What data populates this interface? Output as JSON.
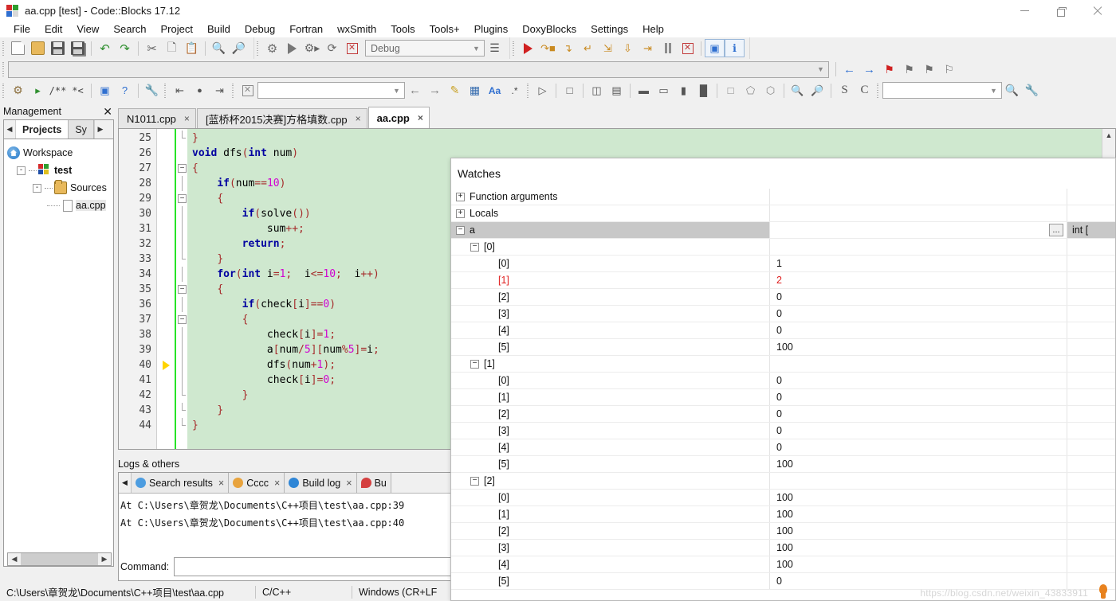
{
  "window": {
    "title": "aa.cpp [test] - Code::Blocks 17.12",
    "app_icon": "codeblocks-icon",
    "controls": {
      "minimize": "minimize-button",
      "maximize": "maximize-button",
      "close": "close-button"
    }
  },
  "menubar": {
    "items": [
      "File",
      "Edit",
      "View",
      "Search",
      "Project",
      "Build",
      "Debug",
      "Fortran",
      "wxSmith",
      "Tools",
      "Tools+",
      "Plugins",
      "DoxyBlocks",
      "Settings",
      "Help"
    ]
  },
  "toolbars": {
    "main": {
      "icons": [
        "new-file-icon",
        "open-file-icon",
        "save-icon",
        "save-all-icon",
        "undo-icon",
        "redo-icon",
        "cut-icon",
        "copy-icon",
        "paste-icon",
        "find-icon",
        "replace-icon"
      ]
    },
    "compiler": {
      "icons": [
        "build-icon",
        "run-icon",
        "build-and-run-icon",
        "rebuild-icon",
        "abort-icon"
      ],
      "target_value": "Debug",
      "target_arrow": "chevron-down-icon",
      "targets_icon": "select-target-icon"
    },
    "debugger": {
      "icons": [
        "debug-continue-icon",
        "next-line-icon",
        "step-into-icon",
        "step-out-icon",
        "next-instruction-icon",
        "step-into-instruction-icon",
        "run-to-cursor-icon",
        "break-debugger-icon",
        "stop-debugger-icon",
        "debugging-windows-icon",
        "various-info-icon"
      ]
    },
    "row2": {
      "combo_value": "",
      "combo_arrow": "chevron-down-icon"
    },
    "row3": {
      "icons": [
        "doxyblocks-extract-icon",
        "doxyblocks-run-icon",
        "comment-block-icon",
        "comment-line-icon",
        "doxywizard-icon",
        "help-icon",
        "doxyblocks-config-icon",
        "back-icon",
        "home-icon",
        "forward-icon",
        "clear-icon"
      ],
      "symbol_combo_value": "",
      "nav_back_icon": "nav-back-icon",
      "nav_forward_icon": "nav-forward-icon",
      "bookmark_icons": [
        "toggle-bookmark-icon",
        "previous-bookmark-icon",
        "next-bookmark-icon",
        "clear-bookmarks-icon"
      ],
      "wxsmith_icons": [
        "pointer-icon",
        "panel-icon",
        "dialog-icon",
        "frame-icon",
        "align-left-icon",
        "align-center-icon",
        "align-right-icon",
        "align-fill-icon",
        "border-none-icon",
        "border-thin-icon",
        "border-thick-icon",
        "zoom-in-icon",
        "zoom-out-icon"
      ],
      "letters": [
        "S",
        "C"
      ],
      "search_combo_value": "",
      "search_icon": "search-declaration-icon",
      "tools_icon": "wrench-icon"
    }
  },
  "management": {
    "caption": "Management",
    "close_icon": "close-icon",
    "nav_left_icon": "chevron-left-icon",
    "nav_right_icon": "chevron-right-icon",
    "tabs": [
      {
        "label": "Projects",
        "active": true
      },
      {
        "label": "Sy",
        "active": false
      }
    ],
    "tree": [
      {
        "label": "Workspace",
        "icon": "workspace-icon",
        "depth": 0,
        "expander": "",
        "bold": false,
        "selected": false
      },
      {
        "label": "test",
        "icon": "project-icon",
        "depth": 1,
        "expander": "-",
        "bold": true,
        "selected": false
      },
      {
        "label": "Sources",
        "icon": "folder-icon",
        "depth": 2,
        "expander": "-",
        "bold": false,
        "selected": false
      },
      {
        "label": "aa.cpp",
        "icon": "file-icon",
        "depth": 3,
        "expander": "",
        "bold": false,
        "selected": true
      }
    ],
    "hscroll": {
      "left_icon": "scroll-left-icon",
      "right_icon": "scroll-right-icon"
    }
  },
  "editor": {
    "tabs": [
      {
        "label": "N1011.cpp",
        "active": false,
        "close": "×"
      },
      {
        "label": "[蓝桥杯2015决赛]方格填数.cpp",
        "active": false,
        "close": "×"
      },
      {
        "label": "aa.cpp",
        "active": true,
        "close": "×"
      }
    ],
    "first_line": 25,
    "active_line": 40,
    "lines": [
      {
        "n": 25,
        "fold": "end",
        "mark": "",
        "tokens": [
          {
            "t": "}",
            "c": "br"
          }
        ],
        "indent": 0
      },
      {
        "n": 26,
        "fold": "",
        "mark": "",
        "tokens": [
          {
            "t": "void ",
            "c": "kw"
          },
          {
            "t": "dfs",
            "c": "id"
          },
          {
            "t": "(",
            "c": "br"
          },
          {
            "t": "int",
            "c": "kw"
          },
          {
            "t": " num",
            "c": "id"
          },
          {
            "t": ")",
            "c": "br"
          }
        ],
        "indent": 0
      },
      {
        "n": 27,
        "fold": "box",
        "mark": "",
        "tokens": [
          {
            "t": "{",
            "c": "br"
          }
        ],
        "indent": 0
      },
      {
        "n": 28,
        "fold": "line",
        "mark": "",
        "tokens": [
          {
            "t": "if",
            "c": "kw"
          },
          {
            "t": "(",
            "c": "br"
          },
          {
            "t": "num",
            "c": "id"
          },
          {
            "t": "==",
            "c": "op"
          },
          {
            "t": "10",
            "c": "num"
          },
          {
            "t": ")",
            "c": "br"
          }
        ],
        "indent": 1
      },
      {
        "n": 29,
        "fold": "box",
        "mark": "",
        "tokens": [
          {
            "t": "{",
            "c": "br"
          }
        ],
        "indent": 1
      },
      {
        "n": 30,
        "fold": "line",
        "mark": "",
        "tokens": [
          {
            "t": "if",
            "c": "kw"
          },
          {
            "t": "(",
            "c": "br"
          },
          {
            "t": "solve",
            "c": "id"
          },
          {
            "t": "())",
            "c": "br"
          }
        ],
        "indent": 2
      },
      {
        "n": 31,
        "fold": "line",
        "mark": "",
        "tokens": [
          {
            "t": "sum",
            "c": "id"
          },
          {
            "t": "++;",
            "c": "op"
          }
        ],
        "indent": 3
      },
      {
        "n": 32,
        "fold": "line",
        "mark": "",
        "tokens": [
          {
            "t": "return",
            "c": "kw"
          },
          {
            "t": ";",
            "c": "op"
          }
        ],
        "indent": 2
      },
      {
        "n": 33,
        "fold": "end",
        "mark": "",
        "tokens": [
          {
            "t": "}",
            "c": "br"
          }
        ],
        "indent": 1
      },
      {
        "n": 34,
        "fold": "line",
        "mark": "",
        "tokens": [
          {
            "t": "for",
            "c": "kw"
          },
          {
            "t": "(",
            "c": "br"
          },
          {
            "t": "int",
            "c": "kw"
          },
          {
            "t": " i",
            "c": "id"
          },
          {
            "t": "=",
            "c": "op"
          },
          {
            "t": "1",
            "c": "num"
          },
          {
            "t": ";",
            "c": "op"
          },
          {
            "t": "  i",
            "c": "id"
          },
          {
            "t": "<=",
            "c": "op"
          },
          {
            "t": "10",
            "c": "num"
          },
          {
            "t": ";",
            "c": "op"
          },
          {
            "t": "  i",
            "c": "id"
          },
          {
            "t": "++",
            "c": "op"
          },
          {
            "t": ")",
            "c": "br"
          }
        ],
        "indent": 1
      },
      {
        "n": 35,
        "fold": "box",
        "mark": "",
        "tokens": [
          {
            "t": "{",
            "c": "br"
          }
        ],
        "indent": 1
      },
      {
        "n": 36,
        "fold": "line",
        "mark": "",
        "tokens": [
          {
            "t": "if",
            "c": "kw"
          },
          {
            "t": "(",
            "c": "br"
          },
          {
            "t": "check",
            "c": "id"
          },
          {
            "t": "[",
            "c": "br"
          },
          {
            "t": "i",
            "c": "id"
          },
          {
            "t": "]",
            "c": "br"
          },
          {
            "t": "==",
            "c": "op"
          },
          {
            "t": "0",
            "c": "num"
          },
          {
            "t": ")",
            "c": "br"
          }
        ],
        "indent": 2
      },
      {
        "n": 37,
        "fold": "box",
        "mark": "",
        "tokens": [
          {
            "t": "{",
            "c": "br"
          }
        ],
        "indent": 2
      },
      {
        "n": 38,
        "fold": "line",
        "mark": "",
        "tokens": [
          {
            "t": "check",
            "c": "id"
          },
          {
            "t": "[",
            "c": "br"
          },
          {
            "t": "i",
            "c": "id"
          },
          {
            "t": "]",
            "c": "br"
          },
          {
            "t": "=",
            "c": "op"
          },
          {
            "t": "1",
            "c": "num"
          },
          {
            "t": ";",
            "c": "op"
          }
        ],
        "indent": 3
      },
      {
        "n": 39,
        "fold": "line",
        "mark": "",
        "tokens": [
          {
            "t": "a",
            "c": "id"
          },
          {
            "t": "[",
            "c": "br"
          },
          {
            "t": "num",
            "c": "id"
          },
          {
            "t": "/",
            "c": "op"
          },
          {
            "t": "5",
            "c": "num"
          },
          {
            "t": "][",
            "c": "br"
          },
          {
            "t": "num",
            "c": "id"
          },
          {
            "t": "%",
            "c": "op"
          },
          {
            "t": "5",
            "c": "num"
          },
          {
            "t": "]",
            "c": "br"
          },
          {
            "t": "=",
            "c": "op"
          },
          {
            "t": "i",
            "c": "id"
          },
          {
            "t": ";",
            "c": "op"
          }
        ],
        "indent": 3
      },
      {
        "n": 40,
        "fold": "line",
        "mark": "arrow",
        "tokens": [
          {
            "t": "dfs",
            "c": "id"
          },
          {
            "t": "(",
            "c": "br"
          },
          {
            "t": "num",
            "c": "id"
          },
          {
            "t": "+",
            "c": "op"
          },
          {
            "t": "1",
            "c": "num"
          },
          {
            "t": ");",
            "c": "br"
          }
        ],
        "indent": 3
      },
      {
        "n": 41,
        "fold": "line",
        "mark": "",
        "tokens": [
          {
            "t": "check",
            "c": "id"
          },
          {
            "t": "[",
            "c": "br"
          },
          {
            "t": "i",
            "c": "id"
          },
          {
            "t": "]",
            "c": "br"
          },
          {
            "t": "=",
            "c": "op"
          },
          {
            "t": "0",
            "c": "num"
          },
          {
            "t": ";",
            "c": "op"
          }
        ],
        "indent": 3
      },
      {
        "n": 42,
        "fold": "end",
        "mark": "",
        "tokens": [
          {
            "t": "}",
            "c": "br"
          }
        ],
        "indent": 2
      },
      {
        "n": 43,
        "fold": "end",
        "mark": "",
        "tokens": [
          {
            "t": "}",
            "c": "br"
          }
        ],
        "indent": 1
      },
      {
        "n": 44,
        "fold": "end",
        "mark": "",
        "tokens": [
          {
            "t": "}",
            "c": "br"
          }
        ],
        "indent": 0
      }
    ],
    "scroll_up_icon": "scroll-up-icon",
    "scroll_down_icon": "scroll-down-icon",
    "hscroll_left_icon": "scroll-left-icon",
    "hscroll_right_icon": "scroll-right-icon"
  },
  "logs": {
    "caption": "Logs & others",
    "nav_left_icon": "chevron-left-icon",
    "tabs": [
      {
        "label": "Search results",
        "icon": "search-icon",
        "color": "#4d9de0",
        "close": "×"
      },
      {
        "label": "Cccc",
        "icon": "pencil-icon",
        "color": "#e8a33d",
        "close": "×"
      },
      {
        "label": "Build log",
        "icon": "gear-blue-icon",
        "color": "#2f86d6",
        "close": "×"
      },
      {
        "label": "Bu",
        "icon": "pin-icon",
        "color": "#d44040",
        "close": ""
      }
    ],
    "lines": [
      "At C:\\Users\\章贺龙\\Documents\\C++项目\\test\\aa.cpp:39",
      "At C:\\Users\\章贺龙\\Documents\\C++项目\\test\\aa.cpp:40"
    ]
  },
  "command_bar": {
    "label": "Command:",
    "value": "",
    "placeholder": ""
  },
  "statusbar": {
    "cells": [
      "C:\\Users\\章贺龙\\Documents\\C++项目\\test\\aa.cpp",
      "C/C++",
      "Windows (CR+LF"
    ]
  },
  "watches": {
    "title": "Watches",
    "columns": [
      "Function arguments",
      "",
      "int ["
    ],
    "rows": [
      {
        "indent": 0,
        "expander": "+",
        "name": "Function arguments",
        "value": "",
        "type": "",
        "selected": false,
        "changed": false,
        "dots": false
      },
      {
        "indent": 0,
        "expander": "+",
        "name": "Locals",
        "value": "",
        "type": "",
        "selected": false,
        "changed": false,
        "dots": false
      },
      {
        "indent": 0,
        "expander": "-",
        "name": "a",
        "value": "",
        "type": "int [",
        "selected": true,
        "changed": false,
        "dots": true
      },
      {
        "indent": 1,
        "expander": "-",
        "name": "[0]",
        "value": "",
        "type": "",
        "selected": false,
        "changed": false,
        "dots": false
      },
      {
        "indent": 2,
        "expander": "",
        "name": "[0]",
        "value": "1",
        "type": "",
        "selected": false,
        "changed": false,
        "dots": false
      },
      {
        "indent": 2,
        "expander": "",
        "name": "[1]",
        "value": "2",
        "type": "",
        "selected": false,
        "changed": true,
        "dots": false
      },
      {
        "indent": 2,
        "expander": "",
        "name": "[2]",
        "value": "0",
        "type": "",
        "selected": false,
        "changed": false,
        "dots": false
      },
      {
        "indent": 2,
        "expander": "",
        "name": "[3]",
        "value": "0",
        "type": "",
        "selected": false,
        "changed": false,
        "dots": false
      },
      {
        "indent": 2,
        "expander": "",
        "name": "[4]",
        "value": "0",
        "type": "",
        "selected": false,
        "changed": false,
        "dots": false
      },
      {
        "indent": 2,
        "expander": "",
        "name": "[5]",
        "value": "100",
        "type": "",
        "selected": false,
        "changed": false,
        "dots": false
      },
      {
        "indent": 1,
        "expander": "-",
        "name": "[1]",
        "value": "",
        "type": "",
        "selected": false,
        "changed": false,
        "dots": false
      },
      {
        "indent": 2,
        "expander": "",
        "name": "[0]",
        "value": "0",
        "type": "",
        "selected": false,
        "changed": false,
        "dots": false
      },
      {
        "indent": 2,
        "expander": "",
        "name": "[1]",
        "value": "0",
        "type": "",
        "selected": false,
        "changed": false,
        "dots": false
      },
      {
        "indent": 2,
        "expander": "",
        "name": "[2]",
        "value": "0",
        "type": "",
        "selected": false,
        "changed": false,
        "dots": false
      },
      {
        "indent": 2,
        "expander": "",
        "name": "[3]",
        "value": "0",
        "type": "",
        "selected": false,
        "changed": false,
        "dots": false
      },
      {
        "indent": 2,
        "expander": "",
        "name": "[4]",
        "value": "0",
        "type": "",
        "selected": false,
        "changed": false,
        "dots": false
      },
      {
        "indent": 2,
        "expander": "",
        "name": "[5]",
        "value": "100",
        "type": "",
        "selected": false,
        "changed": false,
        "dots": false
      },
      {
        "indent": 1,
        "expander": "-",
        "name": "[2]",
        "value": "",
        "type": "",
        "selected": false,
        "changed": false,
        "dots": false
      },
      {
        "indent": 2,
        "expander": "",
        "name": "[0]",
        "value": "100",
        "type": "",
        "selected": false,
        "changed": false,
        "dots": false
      },
      {
        "indent": 2,
        "expander": "",
        "name": "[1]",
        "value": "100",
        "type": "",
        "selected": false,
        "changed": false,
        "dots": false
      },
      {
        "indent": 2,
        "expander": "",
        "name": "[2]",
        "value": "100",
        "type": "",
        "selected": false,
        "changed": false,
        "dots": false
      },
      {
        "indent": 2,
        "expander": "",
        "name": "[3]",
        "value": "100",
        "type": "",
        "selected": false,
        "changed": false,
        "dots": false
      },
      {
        "indent": 2,
        "expander": "",
        "name": "[4]",
        "value": "100",
        "type": "",
        "selected": false,
        "changed": false,
        "dots": false
      },
      {
        "indent": 2,
        "expander": "",
        "name": "[5]",
        "value": "0",
        "type": "",
        "selected": false,
        "changed": false,
        "dots": false
      }
    ]
  },
  "watermark": {
    "text": "https://blog.csdn.net/weixin_43833911",
    "icon": "bulb-icon"
  }
}
